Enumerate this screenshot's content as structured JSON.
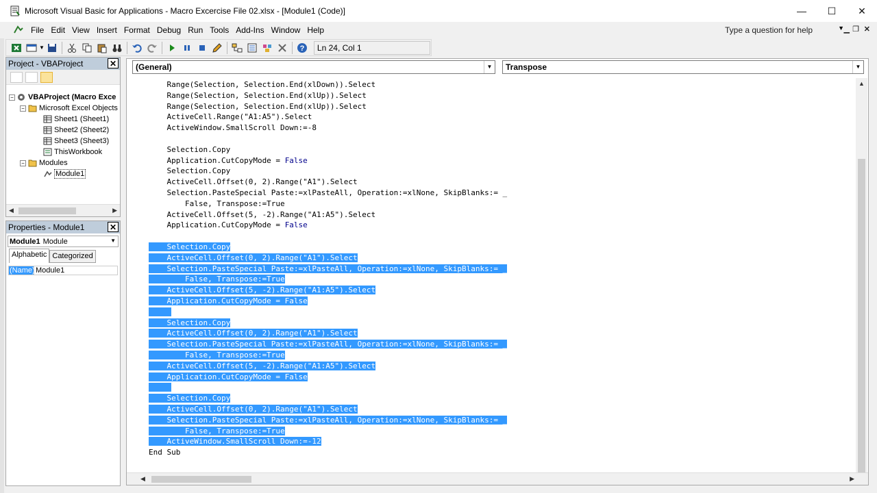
{
  "window": {
    "title": "Microsoft Visual Basic for Applications - Macro Excercise File 02.xlsx - [Module1 (Code)]",
    "minimize": "—",
    "maximize": "☐",
    "close": "✕"
  },
  "menu": {
    "items": [
      "File",
      "Edit",
      "View",
      "Insert",
      "Format",
      "Debug",
      "Run",
      "Tools",
      "Add-Ins",
      "Window",
      "Help"
    ],
    "help_placeholder": "Type a question for help"
  },
  "toolbar": {
    "position": "Ln 24, Col 1"
  },
  "project_panel": {
    "title": "Project - VBAProject",
    "tree": {
      "root": "VBAProject (Macro Exce",
      "excel_objects": "Microsoft Excel Objects",
      "sheet1": "Sheet1 (Sheet1)",
      "sheet2": "Sheet2 (Sheet2)",
      "sheet3": "Sheet3 (Sheet3)",
      "workbook": "ThisWorkbook",
      "modules": "Modules",
      "module1": "Module1"
    }
  },
  "properties_panel": {
    "title": "Properties - Module1",
    "object_name": "Module1",
    "object_type": "Module",
    "tabs": [
      "Alphabetic",
      "Categorized"
    ],
    "row_key": "(Name)",
    "row_value": "Module1"
  },
  "code_window": {
    "object_combo": "(General)",
    "proc_combo": "Transpose",
    "lines": [
      {
        "text": "    Range(Selection, Selection.End(xlDown)).Select",
        "selected": false
      },
      {
        "text": "    Range(Selection, Selection.End(xlUp)).Select",
        "selected": false
      },
      {
        "text": "    Range(Selection, Selection.End(xlUp)).Select",
        "selected": false
      },
      {
        "text": "    ActiveCell.Range(\"A1:A5\").Select",
        "selected": false
      },
      {
        "text": "    ActiveWindow.SmallScroll Down:=-8",
        "selected": false
      },
      {
        "text": "",
        "selected": false
      },
      {
        "text": "    Selection.Copy",
        "selected": false
      },
      {
        "text": "    Application.CutCopyMode = False",
        "selected": false
      },
      {
        "text": "    Selection.Copy",
        "selected": false
      },
      {
        "text": "    ActiveCell.Offset(0, 2).Range(\"A1\").Select",
        "selected": false
      },
      {
        "text": "    Selection.PasteSpecial Paste:=xlPasteAll, Operation:=xlNone, SkipBlanks:= _",
        "selected": false
      },
      {
        "text": "        False, Transpose:=True",
        "selected": false
      },
      {
        "text": "    ActiveCell.Offset(5, -2).Range(\"A1:A5\").Select",
        "selected": false
      },
      {
        "text": "    Application.CutCopyMode = False",
        "selected": false
      },
      {
        "text": "",
        "selected": false
      },
      {
        "text": "    Selection.Copy",
        "selected": true
      },
      {
        "text": "    ActiveCell.Offset(0, 2).Range(\"A1\").Select",
        "selected": true
      },
      {
        "text": "    Selection.PasteSpecial Paste:=xlPasteAll, Operation:=xlNone, SkipBlanks:= _",
        "selected": true
      },
      {
        "text": "        False, Transpose:=True",
        "selected": true
      },
      {
        "text": "    ActiveCell.Offset(5, -2).Range(\"A1:A5\").Select",
        "selected": true
      },
      {
        "text": "    Application.CutCopyMode = False",
        "selected": true
      },
      {
        "text": "",
        "selected": true
      },
      {
        "text": "    Selection.Copy",
        "selected": true
      },
      {
        "text": "    ActiveCell.Offset(0, 2).Range(\"A1\").Select",
        "selected": true
      },
      {
        "text": "    Selection.PasteSpecial Paste:=xlPasteAll, Operation:=xlNone, SkipBlanks:= _",
        "selected": true
      },
      {
        "text": "        False, Transpose:=True",
        "selected": true
      },
      {
        "text": "    ActiveCell.Offset(5, -2).Range(\"A1:A5\").Select",
        "selected": true
      },
      {
        "text": "    Application.CutCopyMode = False",
        "selected": true
      },
      {
        "text": "",
        "selected": true
      },
      {
        "text": "    Selection.Copy",
        "selected": true
      },
      {
        "text": "    ActiveCell.Offset(0, 2).Range(\"A1\").Select",
        "selected": true
      },
      {
        "text": "    Selection.PasteSpecial Paste:=xlPasteAll, Operation:=xlNone, SkipBlanks:= _",
        "selected": true
      },
      {
        "text": "        False, Transpose:=True",
        "selected": true
      },
      {
        "text": "    ActiveWindow.SmallScroll Down:=-12",
        "selected": true
      },
      {
        "text": "End Sub",
        "selected": false
      }
    ]
  },
  "colors": {
    "selection": "#3399ff",
    "keyword": "#00008b",
    "panel_header": "#bfcddb"
  }
}
